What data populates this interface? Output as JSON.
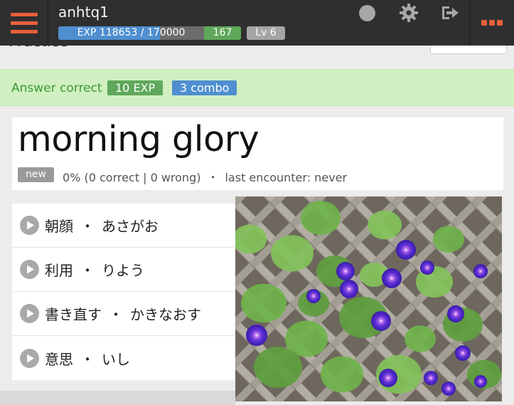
{
  "header": {
    "username": "anhtq1",
    "exp_text": "EXP 118653 / 170000",
    "exp_progress": 0.698,
    "exp_remaining": "167",
    "level": "Lv 6"
  },
  "page": {
    "heading": "Practice"
  },
  "alert": {
    "message": "Answer correct",
    "exp_badge": "10 EXP",
    "combo_badge": "3 combo"
  },
  "word": {
    "title": "morning glory",
    "badge": "new",
    "accuracy": "0% (0 correct | 0 wrong)",
    "separator": "・",
    "last_encounter": "last encounter: never"
  },
  "readings": [
    {
      "kanji": "朝顔",
      "dot": "・",
      "kana": "あさがお"
    },
    {
      "kanji": "利用",
      "dot": "・",
      "kana": "りよう"
    },
    {
      "kanji": "書き直す",
      "dot": "・",
      "kana": "かきなおす"
    },
    {
      "kanji": "意思",
      "dot": "・",
      "kana": "いし"
    }
  ],
  "icons": {
    "menu": "hamburger-icon",
    "status": "circle-icon",
    "settings": "gear-icon",
    "logout": "logout-icon",
    "more": "more-icon",
    "play": "play-icon"
  },
  "colors": {
    "topbar": "#2f2f2f",
    "accent": "#e8603a",
    "exp_blue": "#4f8fcf",
    "green": "#5fa85a",
    "alert_bg": "#d1f0c2",
    "alert_text": "#3c9a30"
  }
}
